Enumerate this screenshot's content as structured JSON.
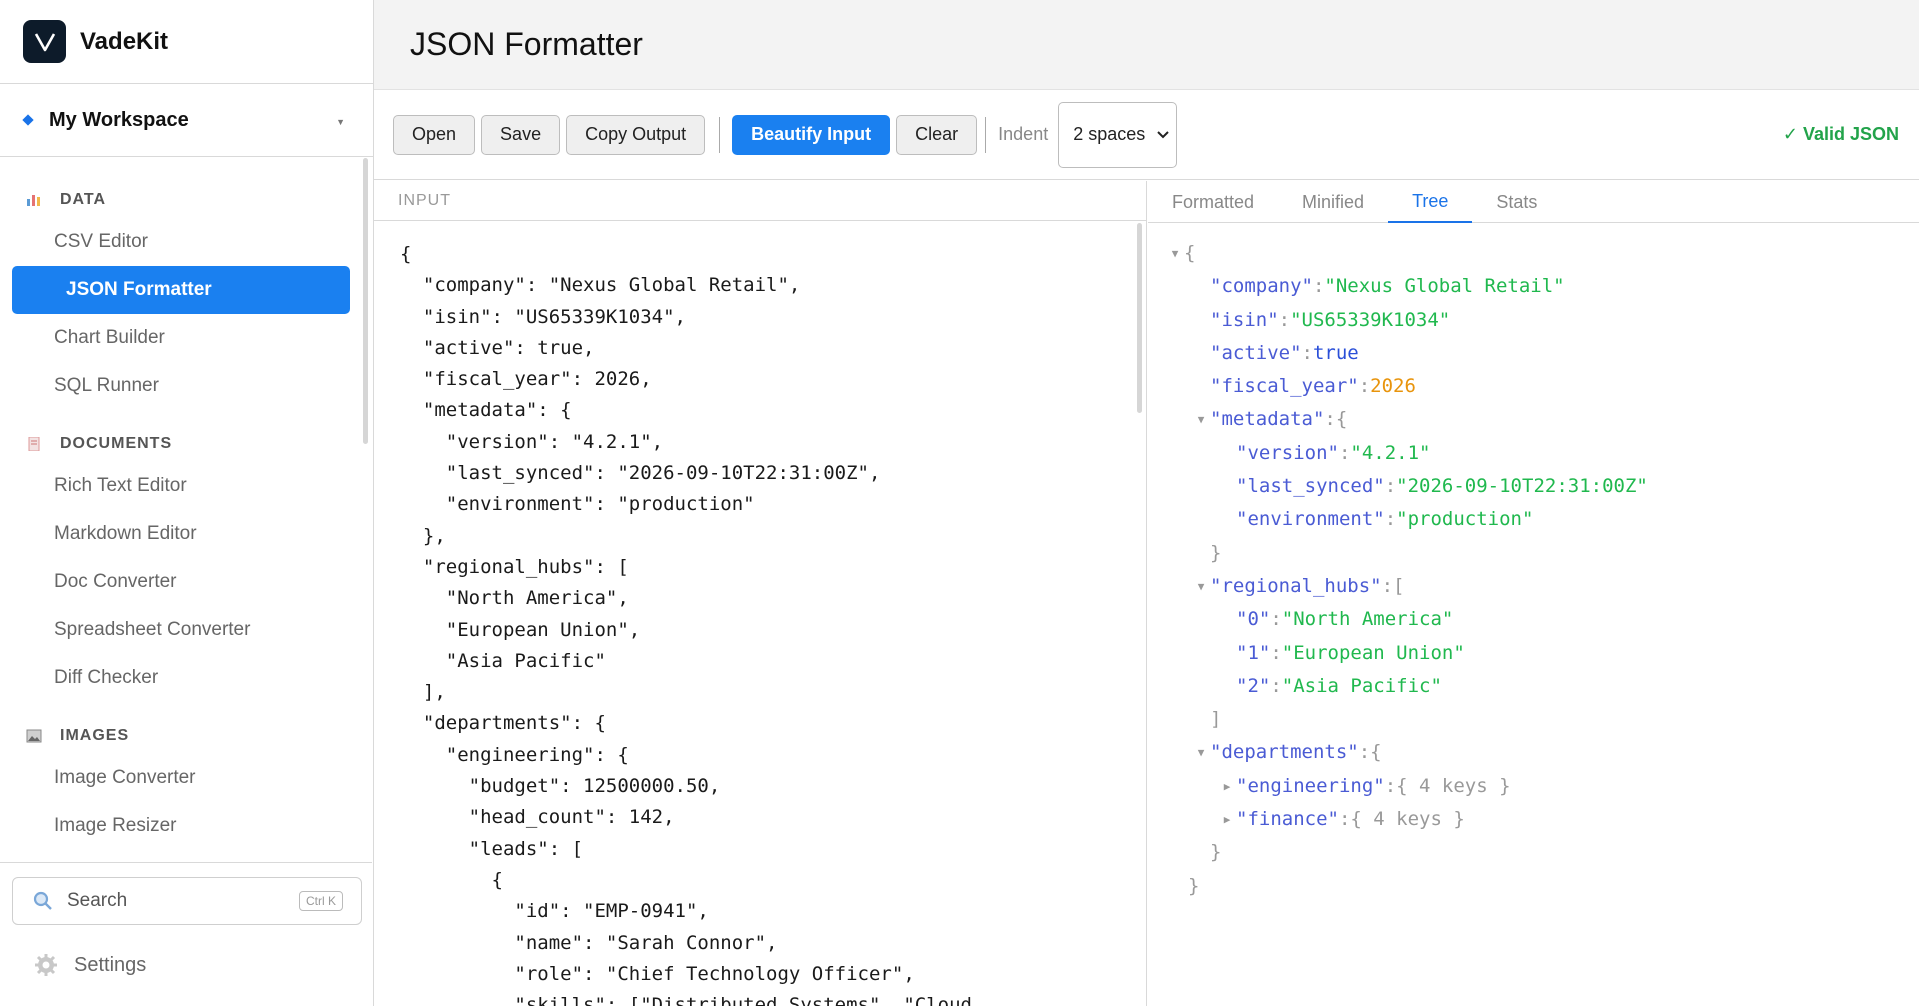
{
  "app": {
    "name": "VadeKit"
  },
  "workspace": {
    "name": "My Workspace"
  },
  "sidebar": {
    "sections": [
      {
        "label": "DATA",
        "items": [
          "CSV Editor",
          "JSON Formatter",
          "Chart Builder",
          "SQL Runner"
        ]
      },
      {
        "label": "DOCUMENTS",
        "items": [
          "Rich Text Editor",
          "Markdown Editor",
          "Doc Converter",
          "Spreadsheet Converter",
          "Diff Checker"
        ]
      },
      {
        "label": "IMAGES",
        "items": [
          "Image Converter",
          "Image Resizer"
        ]
      }
    ],
    "active_item": "JSON Formatter",
    "search_label": "Search",
    "search_shortcut": "Ctrl K",
    "settings_label": "Settings"
  },
  "page": {
    "title": "JSON Formatter"
  },
  "toolbar": {
    "open": "Open",
    "save": "Save",
    "copy_output": "Copy Output",
    "beautify": "Beautify Input",
    "clear": "Clear",
    "indent_label": "Indent",
    "indent_value": "2 spaces",
    "status": "✓ Valid JSON"
  },
  "input_pane": {
    "label": "INPUT",
    "lines": [
      "{",
      "  \"company\": \"Nexus Global Retail\",",
      "  \"isin\": \"US65339K1034\",",
      "  \"active\": true,",
      "  \"fiscal_year\": 2026,",
      "  \"metadata\": {",
      "    \"version\": \"4.2.1\",",
      "    \"last_synced\": \"2026-09-10T22:31:00Z\",",
      "    \"environment\": \"production\"",
      "  },",
      "  \"regional_hubs\": [",
      "    \"North America\",",
      "    \"European Union\",",
      "    \"Asia Pacific\"",
      "  ],",
      "  \"departments\": {",
      "    \"engineering\": {",
      "      \"budget\": 12500000.50,",
      "      \"head_count\": 142,",
      "      \"leads\": [",
      "        {",
      "          \"id\": \"EMP-0941\",",
      "          \"name\": \"Sarah Connor\",",
      "          \"role\": \"Chief Technology Officer\",",
      "          \"skills\": [\"Distributed Systems\", \"Cloud"
    ]
  },
  "output_tabs": [
    "Formatted",
    "Minified",
    "Tree",
    "Stats"
  ],
  "active_output_tab": "Tree",
  "tree": {
    "open_brace": "{",
    "close_brace": "}",
    "company_key": "\"company\"",
    "company_val": "\"Nexus Global Retail\"",
    "isin_key": "\"isin\"",
    "isin_val": "\"US65339K1034\"",
    "active_key": "\"active\"",
    "active_val": "true",
    "fiscal_key": "\"fiscal_year\"",
    "fiscal_val": "2026",
    "metadata_key": "\"metadata\"",
    "version_key": "\"version\"",
    "version_val": "\"4.2.1\"",
    "synced_key": "\"last_synced\"",
    "synced_val": "\"2026-09-10T22:31:00Z\"",
    "env_key": "\"environment\"",
    "env_val": "\"production\"",
    "hubs_key": "\"regional_hubs\"",
    "hub0_key": "\"0\"",
    "hub0_val": "\"North America\"",
    "hub1_key": "\"1\"",
    "hub1_val": "\"European Union\"",
    "hub2_key": "\"2\"",
    "hub2_val": "\"Asia Pacific\"",
    "dept_key": "\"departments\"",
    "eng_key": "\"engineering\"",
    "eng_summary": "{ 4 keys }",
    "fin_key": "\"finance\"",
    "fin_summary": "{ 4 keys }"
  }
}
